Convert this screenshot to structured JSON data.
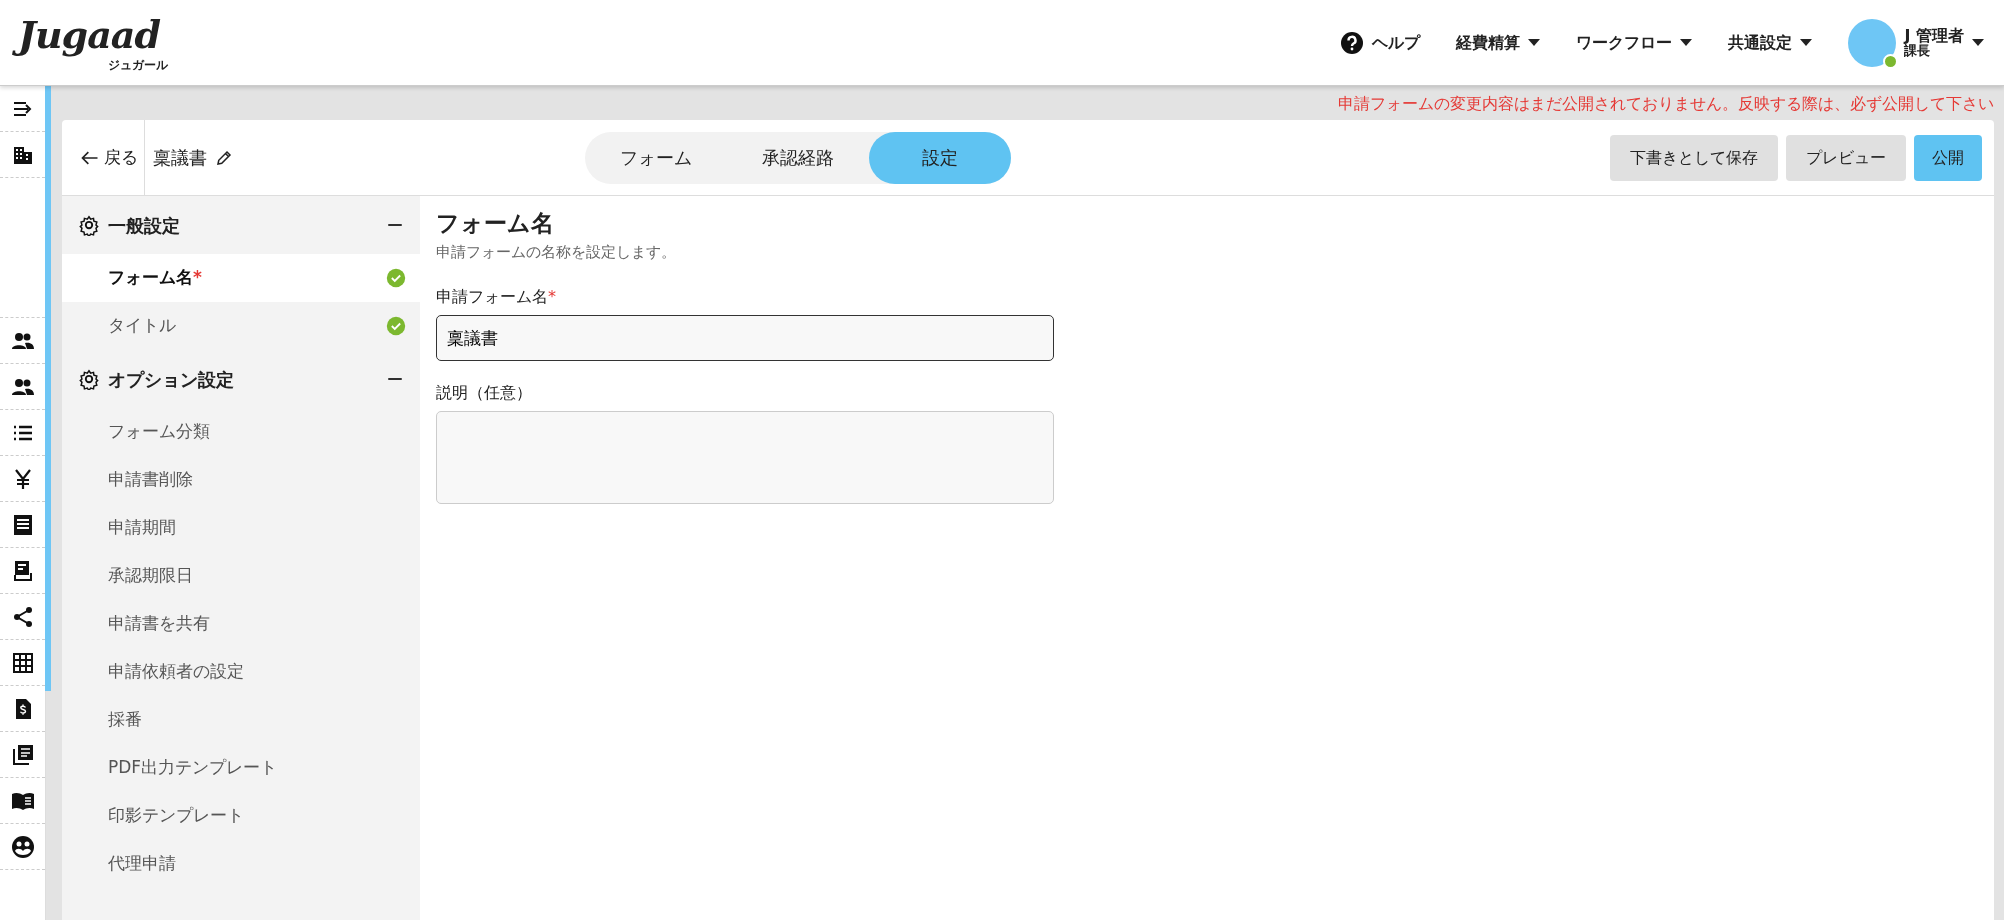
{
  "header": {
    "logo": "Jugaad",
    "logo_sub": "ジュガール",
    "help": "ヘルプ",
    "menus": [
      {
        "label": "経費精算"
      },
      {
        "label": "ワークフロー"
      },
      {
        "label": "共通設定"
      }
    ],
    "user": {
      "name": "J 管理者",
      "role": "課長",
      "online": true
    }
  },
  "notice": "申請フォームの変更内容はまだ公開されておりません。反映する際は、必ず公開して下さい",
  "toolbar": {
    "back": "戻る",
    "form_title": "稟議書",
    "tabs": [
      {
        "label": "フォーム",
        "selected": false
      },
      {
        "label": "承認経路",
        "selected": false
      },
      {
        "label": "設定",
        "selected": true
      }
    ],
    "buttons": [
      {
        "label": "下書きとして保存",
        "kind": "secondary"
      },
      {
        "label": "プレビュー",
        "kind": "secondary"
      },
      {
        "label": "公開",
        "kind": "primary"
      }
    ]
  },
  "sidebar": {
    "sections": [
      {
        "title": "一般設定",
        "expanded": true,
        "items": [
          {
            "label": "フォーム名",
            "required_mark": "*",
            "selected": true,
            "done": true
          },
          {
            "label": "タイトル",
            "selected": false,
            "done": true
          }
        ]
      },
      {
        "title": "オプション設定",
        "expanded": true,
        "items": [
          {
            "label": "フォーム分類",
            "selected": false,
            "done": false
          },
          {
            "label": "申請書削除",
            "selected": false,
            "done": false
          },
          {
            "label": "申請期間",
            "selected": false,
            "done": false
          },
          {
            "label": "承認期限日",
            "selected": false,
            "done": false
          },
          {
            "label": "申請書を共有",
            "selected": false,
            "done": false
          },
          {
            "label": "申請依頼者の設定",
            "selected": false,
            "done": false
          },
          {
            "label": "採番",
            "selected": false,
            "done": false
          },
          {
            "label": "PDF出力テンプレート",
            "selected": false,
            "done": false
          },
          {
            "label": "印影テンプレート",
            "selected": false,
            "done": false
          },
          {
            "label": "代理申請",
            "selected": false,
            "done": false
          }
        ]
      }
    ]
  },
  "content": {
    "heading": "フォーム名",
    "description": "申請フォームの名称を設定します。",
    "fields": [
      {
        "kind": "input",
        "label": "申請フォーム名",
        "required_mark": "*",
        "value": "稟議書"
      },
      {
        "kind": "textarea",
        "label": "説明（任意）"
      }
    ]
  }
}
